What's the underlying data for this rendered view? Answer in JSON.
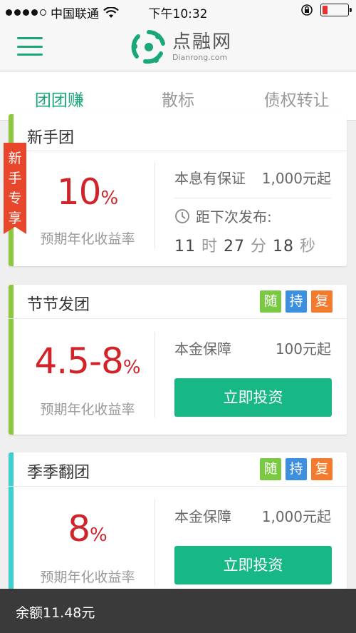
{
  "status_bar": {
    "carrier": "中国联通",
    "time": "下午10:32"
  },
  "header": {
    "logo_cn": "点融网",
    "logo_en": "Dianrong.com",
    "brand_color": "#1aa77a"
  },
  "tabs": [
    {
      "label": "团团赚",
      "active": true
    },
    {
      "label": "散标",
      "active": false
    },
    {
      "label": "债权转让",
      "active": false
    }
  ],
  "newbie_badge": "新手专享",
  "cards": [
    {
      "title": "新手团",
      "rate_num": "10",
      "rate_unit": "%",
      "rate_label": "预期年化收益率",
      "guarantee": "本息有保证",
      "min_amount": "1,000元起",
      "countdown_label": "距下次发布:",
      "countdown": {
        "hours": "11",
        "h_unit": "时",
        "minutes": "27",
        "m_unit": "分",
        "seconds": "18",
        "s_unit": "秒"
      },
      "stripe_color": "#8dc63f"
    },
    {
      "title": "节节发团",
      "tags": [
        "随",
        "持",
        "复"
      ],
      "rate_num": "4.5-8",
      "rate_unit": "%",
      "rate_label": "预期年化收益率",
      "guarantee": "本金保障",
      "min_amount": "100元起",
      "button": "立即投资",
      "stripe_color": "#8dc63f"
    },
    {
      "title": "季季翻团",
      "tags": [
        "随",
        "持",
        "复"
      ],
      "rate_num": "8",
      "rate_unit": "%",
      "rate_label": "预期年化收益率",
      "guarantee": "本金保障",
      "min_amount": "1,000元起",
      "button": "立即投资",
      "stripe_color": "#3fcfcf"
    }
  ],
  "tag_colors": [
    "#7ac943",
    "#3d8fe0",
    "#f47a2e"
  ],
  "bottom_bar": {
    "balance": "余额11.48元"
  }
}
